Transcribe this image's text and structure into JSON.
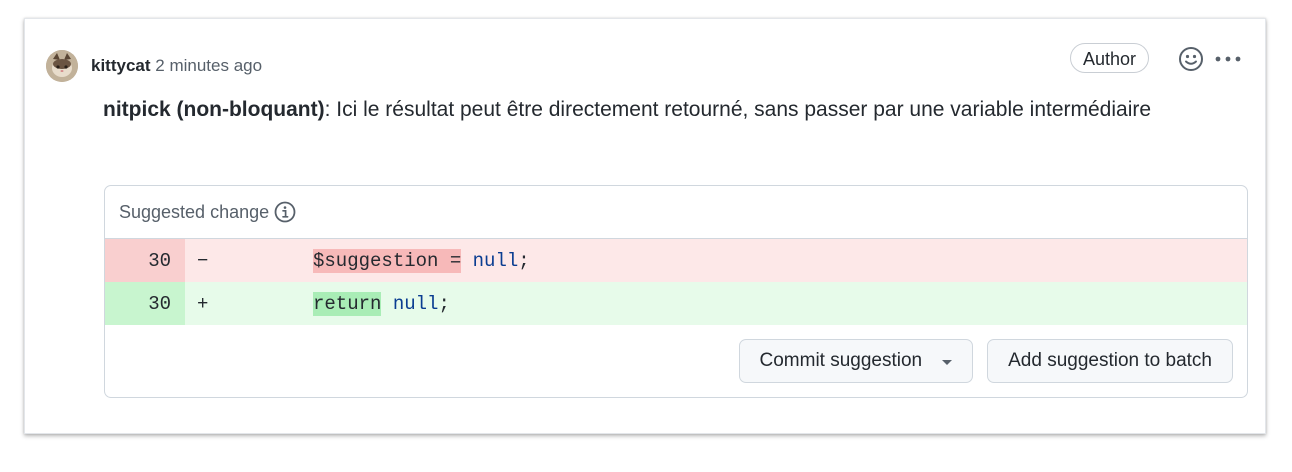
{
  "comment": {
    "author": "kittycat",
    "time": "2 minutes ago",
    "badge": "Author",
    "body_bold": "nitpick (non-bloquant)",
    "body_text": ": Ici le résultat peut être directement retourné, sans passer par une variable intermédiaire"
  },
  "suggestion": {
    "header": "Suggested change",
    "lines": [
      {
        "type": "deletion",
        "number": "30",
        "sign": "−",
        "highlight": "$suggestion =",
        "rest_space": " ",
        "keyword": "null",
        "tail": ";"
      },
      {
        "type": "addition",
        "number": "30",
        "sign": "+",
        "highlight": "return",
        "rest_space": " ",
        "keyword": "null",
        "tail": ";"
      }
    ],
    "commit_button": "Commit suggestion",
    "batch_button": "Add suggestion to batch"
  },
  "icons": {
    "avatar": "cat-avatar",
    "reaction": "smiley-icon",
    "menu": "kebab-horizontal-icon",
    "info": "info-icon"
  },
  "colors": {
    "deletion_bg": "#fde8e8",
    "addition_bg": "#e7fbea",
    "keyword": "#0a3d91"
  }
}
